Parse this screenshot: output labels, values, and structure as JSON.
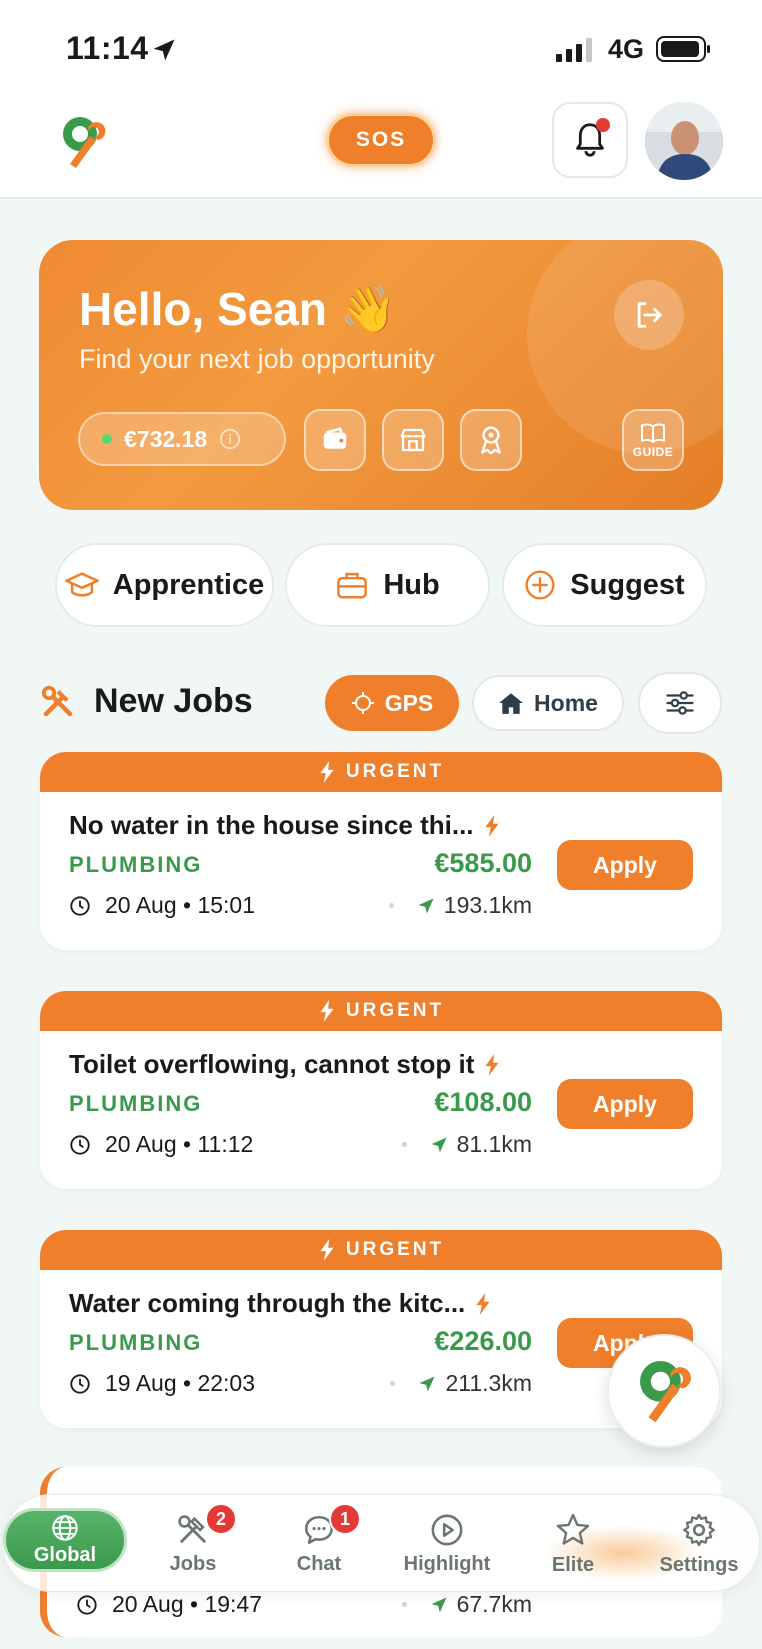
{
  "status_bar": {
    "time": "11:14",
    "network": "4G"
  },
  "header": {
    "sos_label": "SOS"
  },
  "hero": {
    "greeting": "Hello, Sean 👋",
    "subtitle": "Find your next job opportunity",
    "balance": "€732.18",
    "guide_label": "GUIDE"
  },
  "quick_actions": [
    {
      "label": "Apprentice",
      "icon": "graduation-cap-icon"
    },
    {
      "label": "Hub",
      "icon": "briefcase-icon"
    },
    {
      "label": "Suggest",
      "icon": "plus-circle-icon"
    }
  ],
  "jobs_section": {
    "title": "New Jobs",
    "filters": {
      "gps": "GPS",
      "home": "Home"
    }
  },
  "jobs": [
    {
      "badge": "URGENT",
      "title": "No water in the house since thi...",
      "category": "PLUMBING",
      "price": "€585.00",
      "date": "20 Aug • 15:01",
      "distance": "193.1km",
      "action": "Apply"
    },
    {
      "badge": "URGENT",
      "title": "Toilet overflowing, cannot stop it",
      "category": "PLUMBING",
      "price": "€108.00",
      "date": "20 Aug • 11:12",
      "distance": "81.1km",
      "action": "Apply"
    },
    {
      "badge": "URGENT",
      "title": "Water coming through the kitc...",
      "category": "PLUMBING",
      "price": "€226.00",
      "date": "19 Aug • 22:03",
      "distance": "211.3km",
      "action": "Apply"
    }
  ],
  "partial_job": {
    "date": "20 Aug • 19:47",
    "distance": "67.7km"
  },
  "bottom_nav": [
    {
      "label": "Global",
      "icon": "globe-icon"
    },
    {
      "label": "Jobs",
      "icon": "hammer-wrench-icon",
      "badge": "2"
    },
    {
      "label": "Chat",
      "icon": "chat-bubble-icon",
      "badge": "1"
    },
    {
      "label": "Highlight",
      "icon": "play-circle-icon"
    },
    {
      "label": "Elite",
      "icon": "star-icon"
    },
    {
      "label": "Settings",
      "icon": "gear-icon"
    }
  ],
  "colors": {
    "accent": "#f07f2c",
    "success": "#3a9a4b",
    "badge": "#e53935"
  }
}
